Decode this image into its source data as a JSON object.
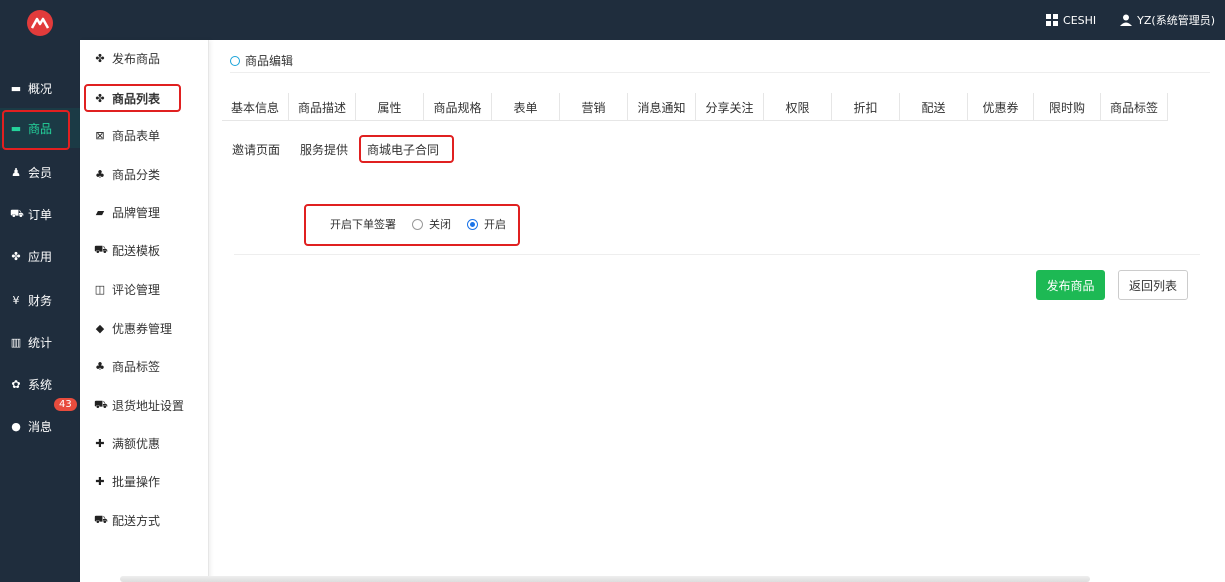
{
  "topbar": {
    "shop_label": "CESHI",
    "user_label": "YZ(系统管理员)"
  },
  "rail": {
    "items": [
      {
        "label": "概况",
        "icon": "overview-icon"
      },
      {
        "label": "商品",
        "icon": "goods-icon",
        "active": true
      },
      {
        "label": "会员",
        "icon": "members-icon"
      },
      {
        "label": "订单",
        "icon": "cart-icon"
      },
      {
        "label": "应用",
        "icon": "apps-icon"
      },
      {
        "label": "财务",
        "icon": "yen-icon"
      },
      {
        "label": "统计",
        "icon": "bar-chart-icon"
      },
      {
        "label": "系统",
        "icon": "gears-icon"
      },
      {
        "label": "消息",
        "icon": "comment-icon"
      }
    ],
    "message_badge": "43"
  },
  "submenu": {
    "items": [
      {
        "label": "发布商品"
      },
      {
        "label": "商品列表",
        "active": true
      },
      {
        "label": "商品表单"
      },
      {
        "label": "商品分类"
      },
      {
        "label": "品牌管理"
      },
      {
        "label": "配送模板"
      },
      {
        "label": "评论管理"
      },
      {
        "label": "优惠券管理"
      },
      {
        "label": "商品标签"
      },
      {
        "label": "退货地址设置"
      },
      {
        "label": "满额优惠"
      },
      {
        "label": "批量操作"
      },
      {
        "label": "配送方式"
      }
    ]
  },
  "main": {
    "breadcrumb": "商品编辑",
    "tabs_row1": [
      "基本信息",
      "商品描述",
      "属性",
      "商品规格",
      "表单",
      "营销",
      "消息通知",
      "分享关注",
      "权限",
      "折扣",
      "配送",
      "优惠券",
      "限时购",
      "商品标签"
    ],
    "tabs_row2": [
      "邀请页面",
      "服务提供",
      "商城电子合同"
    ],
    "active_tab": "商城电子合同",
    "sign_label": "开启下单签署",
    "option_off": "关闭",
    "option_on": "开启",
    "selected_option": "开启",
    "publish_button": "发布商品",
    "back_button": "返回列表"
  },
  "colors": {
    "sidebar_bg": "#1f2d3d",
    "active_green": "#24d39b",
    "highlight_red": "#e02020",
    "primary_button": "#1db954",
    "badge_red": "#e84c3d"
  }
}
